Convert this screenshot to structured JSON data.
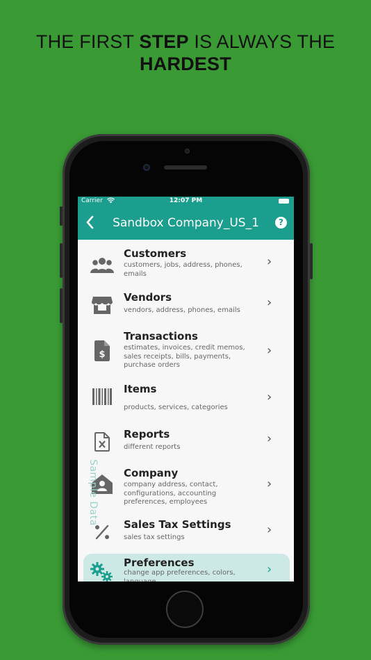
{
  "headline": {
    "line1_pre": "THE FIRST ",
    "line1_bold": "STEP",
    "line1_post": " IS ALWAYS THE",
    "line2_bold": "HARDEST"
  },
  "statusbar": {
    "carrier": "Carrier",
    "time": "12:07 PM"
  },
  "navbar": {
    "title": "Sandbox Company_US_1",
    "back_icon": "chevron-left-icon",
    "help_label": "?"
  },
  "watermark": "Sample Data",
  "menu": [
    {
      "title": "Customers",
      "subtitle": "customers, jobs, address, phones, emails",
      "icon": "people-icon"
    },
    {
      "title": "Vendors",
      "subtitle": "vendors, address, phones, emails",
      "icon": "store-icon"
    },
    {
      "title": "Transactions",
      "subtitle": "estimates, invoices, credit memos, sales receipts, bills, payments, purchase orders",
      "icon": "receipt-dollar-icon"
    },
    {
      "title": "Items",
      "subtitle": "products, services, categories",
      "icon": "barcode-icon"
    },
    {
      "title": "Reports",
      "subtitle": "different reports",
      "icon": "report-file-icon"
    },
    {
      "title": "Company",
      "subtitle": "company address, contact, configurations, accounting preferences, employees",
      "icon": "home-user-icon"
    },
    {
      "title": "Sales Tax Settings",
      "subtitle": "sales tax settings",
      "icon": "percent-icon"
    },
    {
      "title": "Preferences",
      "subtitle": "change app preferences, colors, language",
      "icon": "gears-icon",
      "active": true
    }
  ],
  "colors": {
    "background": "#3a9b35",
    "accent": "#1b9e8e",
    "active_row": "#cde9e6"
  }
}
